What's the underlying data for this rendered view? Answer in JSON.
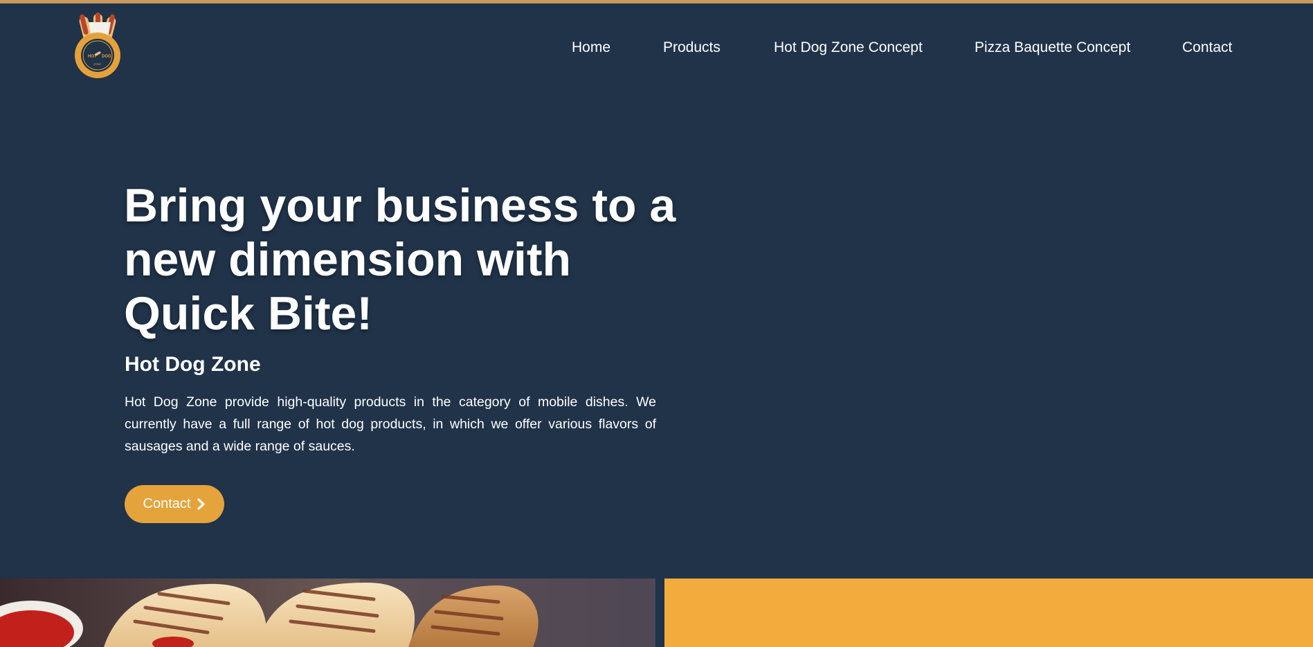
{
  "theme": {
    "background": "#203349",
    "accent": "#e5a33c",
    "panel": "#f4ab3e",
    "top_strip": "#c79a5e"
  },
  "logo": {
    "icon": "hot-dog-logo-icon",
    "ring_text_left": "STREET FOOD",
    "ring_text_right": "CONCEPT",
    "word_left": "HOT",
    "word_right": "DOG",
    "word_small": "ZONE"
  },
  "nav": {
    "items": [
      {
        "label": "Home"
      },
      {
        "label": "Products"
      },
      {
        "label": "Hot Dog Zone Concept"
      },
      {
        "label": "Pizza Baquette Concept"
      },
      {
        "label": "Contact"
      }
    ]
  },
  "hero": {
    "title": "Bring your business to a new dimension with Quick Bite!",
    "subtitle": "Hot Dog Zone",
    "description": "Hot Dog Zone provide high-quality products in the category of mobile dishes. We currently have a full range of hot dog products, in which we offer various flavors of sausages and a wide range of sauces.",
    "cta_label": "Contact",
    "cta_icon": "chevron-right-icon"
  },
  "sections": {
    "left_image": "hot-dog-baguettes-photo",
    "right_panel": "orange-panel"
  }
}
